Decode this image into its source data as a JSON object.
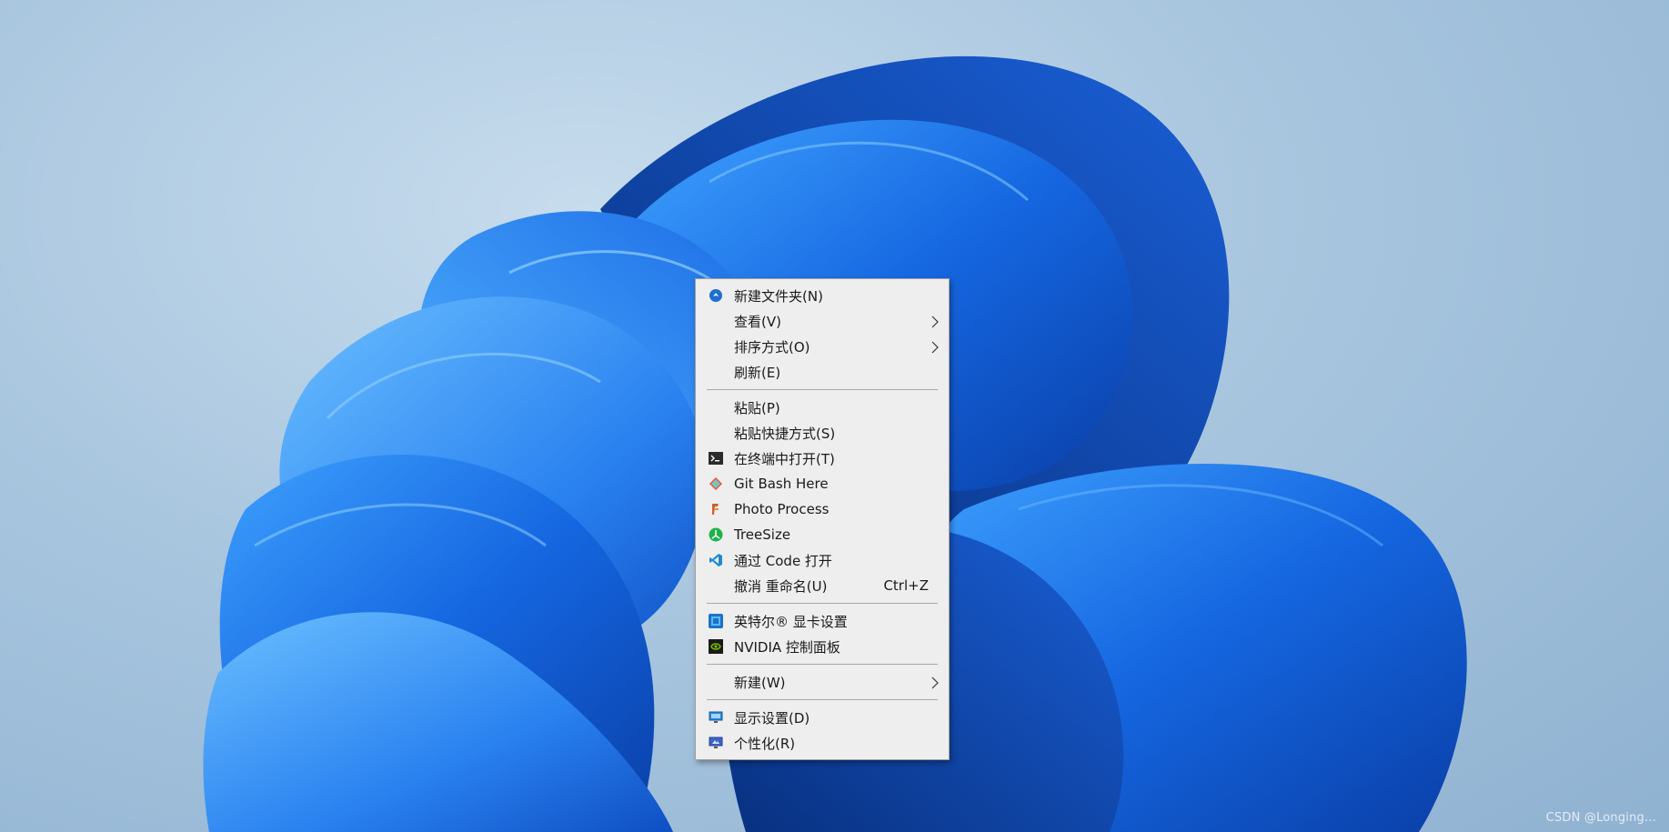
{
  "desktop": {
    "watermark": "CSDN @Longing..."
  },
  "context_menu": {
    "groups": [
      [
        {
          "label": "新建文件夹(N)",
          "icon": "new-folder-icon",
          "shortcut": "",
          "submenu": false
        },
        {
          "label": "查看(V)",
          "icon": "",
          "shortcut": "",
          "submenu": true
        },
        {
          "label": "排序方式(O)",
          "icon": "",
          "shortcut": "",
          "submenu": true
        },
        {
          "label": "刷新(E)",
          "icon": "",
          "shortcut": "",
          "submenu": false
        }
      ],
      [
        {
          "label": "粘贴(P)",
          "icon": "",
          "shortcut": "",
          "submenu": false
        },
        {
          "label": "粘贴快捷方式(S)",
          "icon": "",
          "shortcut": "",
          "submenu": false
        },
        {
          "label": "在终端中打开(T)",
          "icon": "terminal-icon",
          "shortcut": "",
          "submenu": false
        },
        {
          "label": "Git Bash Here",
          "icon": "git-bash-icon",
          "shortcut": "",
          "submenu": false
        },
        {
          "label": "Photo Process",
          "icon": "photo-process-icon",
          "shortcut": "",
          "submenu": false
        },
        {
          "label": "TreeSize",
          "icon": "treesize-icon",
          "shortcut": "",
          "submenu": false
        },
        {
          "label": "通过 Code 打开",
          "icon": "vscode-icon",
          "shortcut": "",
          "submenu": false
        },
        {
          "label": "撤消 重命名(U)",
          "icon": "",
          "shortcut": "Ctrl+Z",
          "submenu": false
        }
      ],
      [
        {
          "label": "英特尔® 显卡设置",
          "icon": "intel-graphics-icon",
          "shortcut": "",
          "submenu": false
        },
        {
          "label": "NVIDIA 控制面板",
          "icon": "nvidia-icon",
          "shortcut": "",
          "submenu": false
        }
      ],
      [
        {
          "label": "新建(W)",
          "icon": "",
          "shortcut": "",
          "submenu": true
        }
      ],
      [
        {
          "label": "显示设置(D)",
          "icon": "display-settings-icon",
          "shortcut": "",
          "submenu": false
        },
        {
          "label": "个性化(R)",
          "icon": "personalize-icon",
          "shortcut": "",
          "submenu": false
        }
      ]
    ]
  },
  "colors": {
    "menu_background": "#eeeeee",
    "wallpaper_blue": "#1a6ee8",
    "background_sky": "#a9c6df"
  }
}
